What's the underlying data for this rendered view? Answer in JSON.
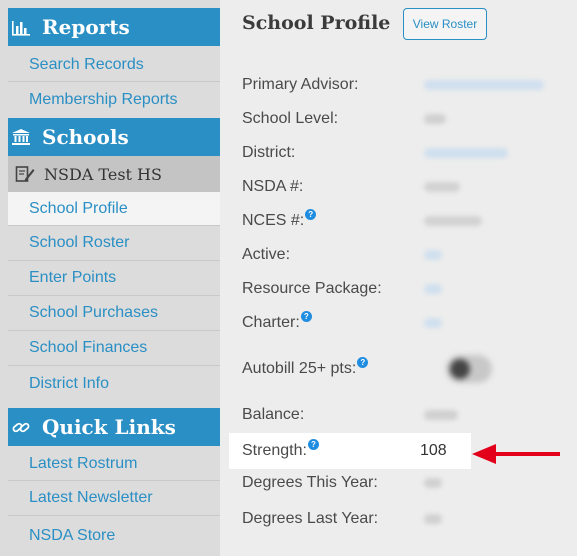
{
  "sidebar": {
    "reports": {
      "title": "Reports",
      "icon": "bar-chart-icon",
      "items": [
        "Search Records",
        "Membership Reports"
      ]
    },
    "schools": {
      "title": "Schools",
      "icon": "institution-icon",
      "school_name": "NSDA Test HS",
      "school_icon": "edit-note-icon",
      "items": [
        "School Profile",
        "School Roster",
        "Enter Points",
        "School Purchases",
        "School Finances",
        "District Info"
      ],
      "active_item": "School Profile"
    },
    "quick_links": {
      "title": "Quick Links",
      "icon": "link-icon",
      "items": [
        "Latest Rostrum",
        "Latest Newsletter",
        "NSDA Store"
      ]
    }
  },
  "main": {
    "title": "School Profile",
    "view_roster_label": "View Roster",
    "fields": [
      {
        "label": "Primary Advisor:"
      },
      {
        "label": "School Level:"
      },
      {
        "label": "District:"
      },
      {
        "label": "NSDA #:"
      },
      {
        "label": "NCES #:",
        "help": true
      },
      {
        "label": "Active:"
      },
      {
        "label": "Resource Package:"
      },
      {
        "label": "Charter:",
        "help": true
      },
      {
        "label": "Autobill 25+ pts:",
        "help": true
      },
      {
        "label": "Balance:"
      },
      {
        "label": "Strength:",
        "help": true,
        "value": "108"
      },
      {
        "label": "Degrees This Year:"
      },
      {
        "label": "Degrees Last Year:"
      }
    ],
    "help_glyph": "?"
  },
  "colors": {
    "accent": "#2a8fc4",
    "annotation_arrow": "#e3001b"
  }
}
